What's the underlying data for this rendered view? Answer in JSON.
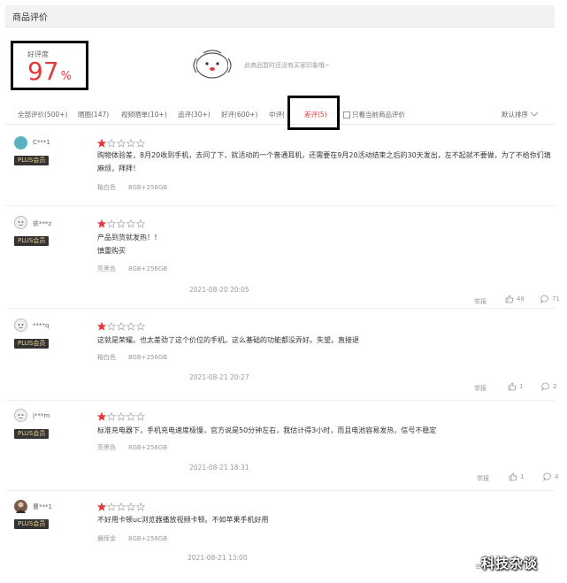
{
  "section_title": "商品评价",
  "summary": {
    "label": "好评度",
    "score": "97",
    "unit": "%",
    "impression_text": "此商品暂时还没有买家印象哦~"
  },
  "filters": {
    "tabs": [
      {
        "label": "全部评价(500+)"
      },
      {
        "label": "晒图(147)"
      },
      {
        "label": "视频晒单(10+)"
      },
      {
        "label": "追评(30+)"
      },
      {
        "label": "好评(600+)"
      },
      {
        "label": "中评("
      },
      {
        "label": "差评(5)"
      }
    ],
    "only_current": "只看当前商品评价",
    "sort": "默认排序"
  },
  "reviews": [
    {
      "user": "C***1",
      "badge": "PLUS会员",
      "text": "购物体验差，8月20收到手机，去问了下，就活动的一个普通耳机，还需要在9月20活动结束之后的30天发出，左不起就不要做，为了不给你们填麻烦，拜拜！",
      "color": "釉白色",
      "storage": "8GB+256GB",
      "rating": 1
    },
    {
      "user": "依***z",
      "badge": "PLUS会员",
      "text_lines": [
        "产品到货就发热！！",
        "慎重购买"
      ],
      "color": "亮黑色",
      "storage": "8GB+256GB",
      "date": "2021-08-20 20:05",
      "report": "举报",
      "likes": "48",
      "comments": "71",
      "rating": 1
    },
    {
      "user": "****q",
      "badge": "PLUS会员",
      "text": "这就是荣耀。也太差劲了这个价位的手机。这么基础的功能都没弄好。失望。直接退",
      "color": "釉白色",
      "storage": "8GB+256GB",
      "date": "2021-08-21 20:27",
      "report": "举报",
      "likes": "1",
      "comments": "2",
      "rating": 1
    },
    {
      "user": "j***m",
      "badge": "PLUS会员",
      "text": "标准充电器下，手机充电速度极慢，官方说是50分钟左右，我估计得3小时，而且电池容易发热，信号不稳定",
      "color": "亮黑色",
      "storage": "8GB+256GB",
      "date": "2021-08-21 18:31",
      "report": "举报",
      "likes": "1",
      "comments": "4",
      "rating": 1
    },
    {
      "user": "曹***1",
      "badge": "PLUS会员",
      "text": "不好用卡顿uc浏览器播放视频卡顿。不如苹果手机好用",
      "color": "晨晖金",
      "storage": "8GB+256GB",
      "date": "2021-08-21 13:00",
      "report": "举报",
      "rating": 1
    }
  ],
  "watermark": "科技杂谈",
  "colors": {
    "accent": "#e4393c",
    "badge_bg": "#333333",
    "badge_text": "#f1d08b"
  }
}
